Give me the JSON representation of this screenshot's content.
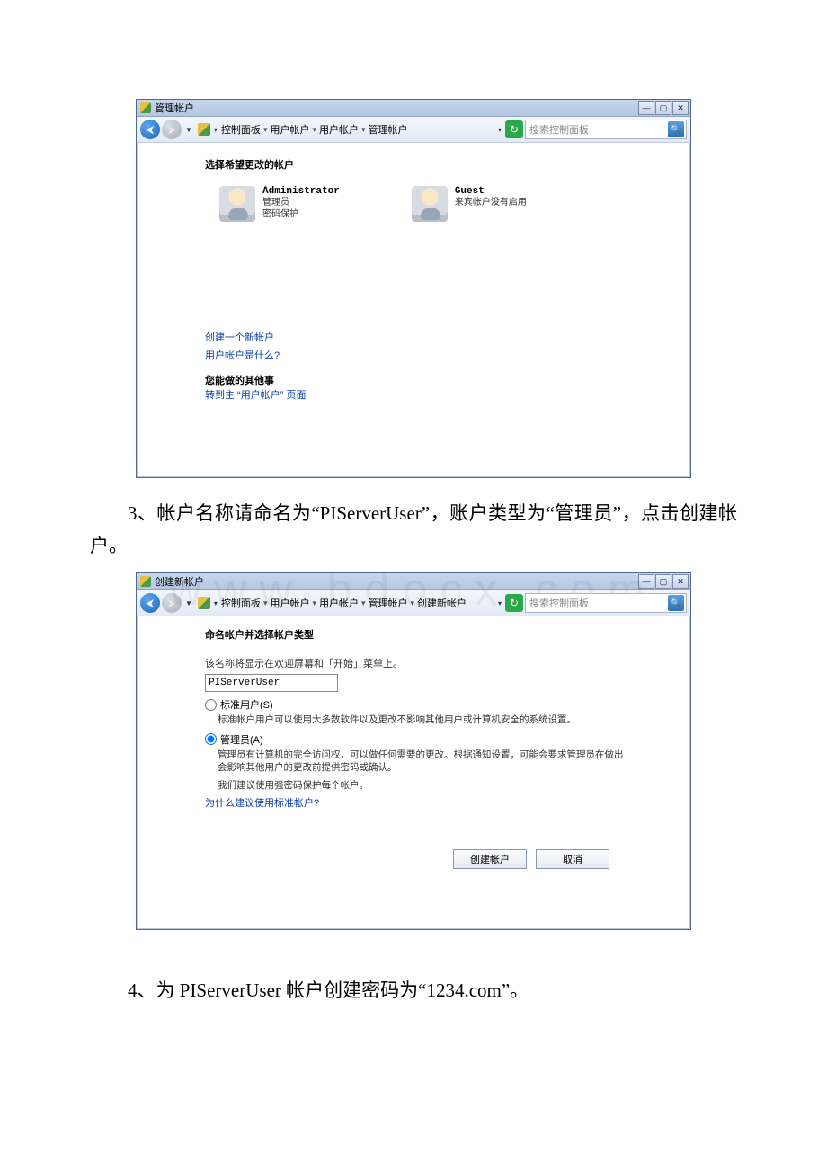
{
  "watermark": "www.bdocx.com",
  "window1": {
    "title": "管理帐户",
    "breadcrumb": [
      "控制面板",
      "用户帐户",
      "用户帐户",
      "管理帐户"
    ],
    "search_placeholder": "搜索控制面板",
    "heading": "选择希望更改的帐户",
    "accounts": [
      {
        "name": "Administrator",
        "line2": "管理员",
        "line3": "密码保护"
      },
      {
        "name": "Guest",
        "line2": "来宾帐户没有启用",
        "line3": ""
      }
    ],
    "link_create": "创建一个新帐户",
    "link_what": "用户帐户是什么?",
    "other_heading": "您能做的其他事",
    "link_main": "转到主 “用户帐户” 页面"
  },
  "instruction3": "3、帐户名称请命名为“PIServerUser”，账户类型为“管理员”，点击创建帐户。",
  "window2": {
    "title": "创建新帐户",
    "breadcrumb": [
      "控制面板",
      "用户帐户",
      "用户帐户",
      "管理帐户",
      "创建新帐户"
    ],
    "search_placeholder": "搜索控制面板",
    "heading": "命名帐户并选择帐户类型",
    "desc": "该名称将显示在欢迎屏幕和「开始」菜单上。",
    "input_value": "PIServerUser",
    "radio_standard_label": "标准用户(S)",
    "radio_standard_desc": "标准帐户用户可以使用大多数软件以及更改不影响其他用户或计算机安全的系统设置。",
    "radio_admin_label": "管理员(A)",
    "radio_admin_desc": "管理员有计算机的完全访问权，可以做任何需要的更改。根据通知设置，可能会要求管理员在做出会影响其他用户的更改前提供密码或确认。",
    "recommend": "我们建议使用强密码保护每个帐户。",
    "link_why": "为什么建议使用标准帐户?",
    "btn_create": "创建帐户",
    "btn_cancel": "取消"
  },
  "instruction4": "4、为 PIServerUser 帐户创建密码为“1234.com”。"
}
